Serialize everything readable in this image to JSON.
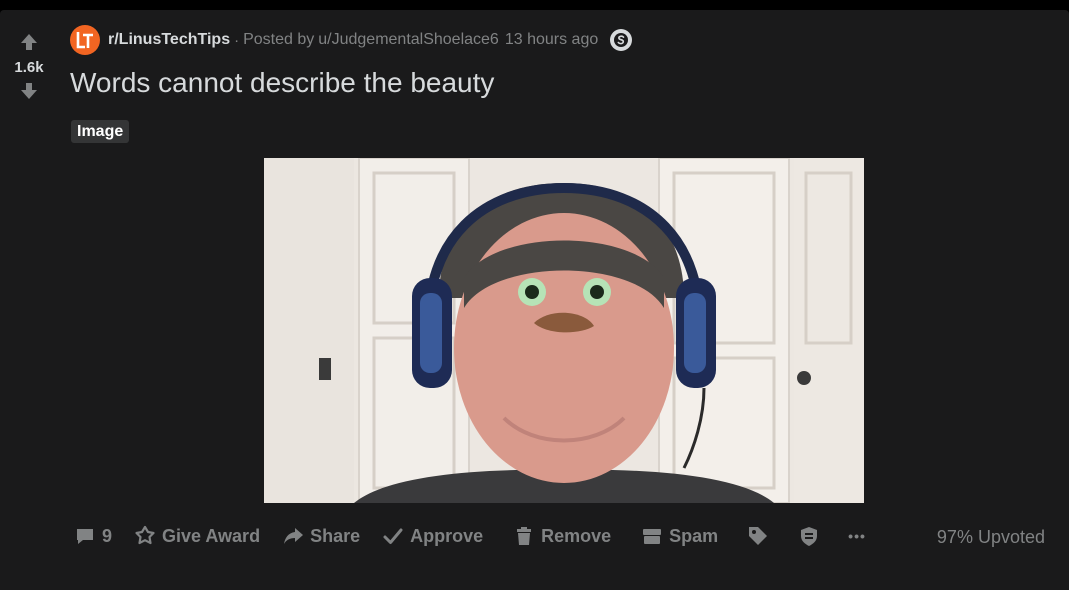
{
  "vote": {
    "count": "1.6k",
    "upvote_icon": "arrow-up-icon",
    "downvote_icon": "arrow-down-icon"
  },
  "post": {
    "subreddit": "r/LinusTechTips",
    "separator": "·",
    "posted_by_prefix": "Posted by",
    "author": "u/JudgementalShoelace6",
    "time": "13 hours ago",
    "title": "Words cannot describe the beauty",
    "flair": "Image",
    "image_description_icon": "meme-photo-image",
    "subreddit_logo_letters": "LT",
    "mod_badge_letter": "S"
  },
  "actions": {
    "comments_count": "9",
    "give_award": "Give Award",
    "share": "Share",
    "approve": "Approve",
    "remove": "Remove",
    "spam": "Spam",
    "more": "•••",
    "upvoted": "97% Upvoted"
  },
  "colors": {
    "card_bg": "#1a1a1b",
    "page_bg": "#000000",
    "text_primary": "#d7dadc",
    "text_secondary": "#818384",
    "brand_orange": "#f26522",
    "flair_bg": "#343536"
  }
}
